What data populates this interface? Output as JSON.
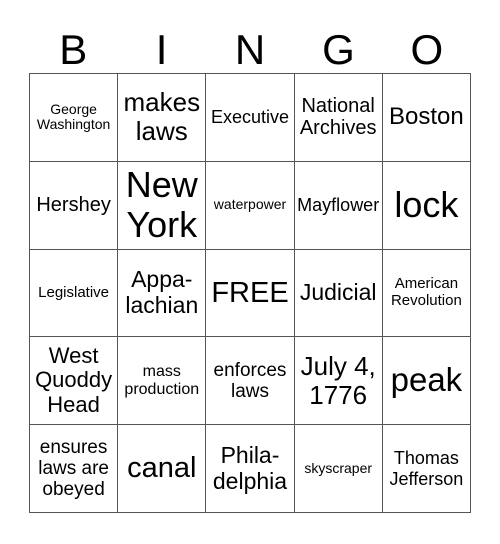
{
  "header": {
    "letters": [
      "B",
      "I",
      "N",
      "G",
      "O"
    ]
  },
  "grid": {
    "cells": [
      [
        "George Washington",
        "makes laws",
        "Executive",
        "National Archives",
        "Boston"
      ],
      [
        "Hershey",
        "New York",
        "waterpower",
        "Mayflower",
        "lock"
      ],
      [
        "Legislative",
        "Appa-\nlachian",
        "FREE",
        "Judicial",
        "American Revolution"
      ],
      [
        "West Quoddy Head",
        "mass production",
        "enforces laws",
        "July 4, 1776",
        "peak"
      ],
      [
        "ensures laws are obeyed",
        "canal",
        "Phila-\ndelphia",
        "skyscraper",
        "Thomas Jefferson"
      ]
    ],
    "free_space": {
      "row": 2,
      "col": 2
    }
  }
}
